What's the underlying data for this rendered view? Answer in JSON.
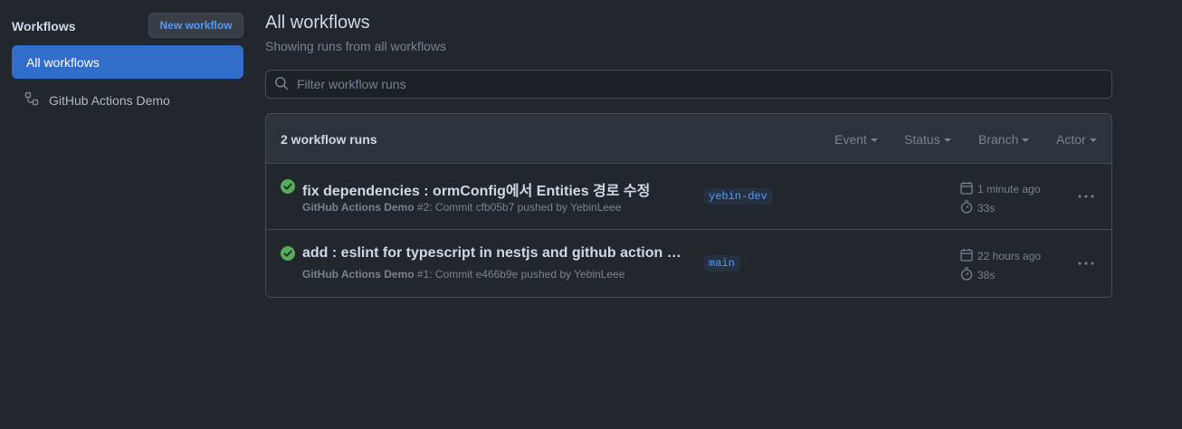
{
  "sidebar": {
    "title": "Workflows",
    "new_button": "New workflow",
    "items": [
      {
        "label": "All workflows",
        "active": true
      },
      {
        "label": "GitHub Actions Demo",
        "icon": "workflow-icon"
      }
    ]
  },
  "main": {
    "title": "All workflows",
    "subtitle": "Showing runs from all workflows",
    "filter_placeholder": "Filter workflow runs",
    "runs_count": "2 workflow runs",
    "filters": [
      "Event",
      "Status",
      "Branch",
      "Actor"
    ]
  },
  "runs": [
    {
      "status": "success",
      "title": "fix dependencies : ormConfig에서 Entities 경로 수정",
      "workflow": "GitHub Actions Demo",
      "meta": " #2: Commit cfb05b7 pushed by YebinLeee",
      "branch": "yebin-dev",
      "when": "1 minute ago",
      "duration": "33s"
    },
    {
      "status": "success",
      "title": "add : eslint for typescript in nestjs and github action workflow",
      "workflow": "GitHub Actions Demo",
      "meta": " #1: Commit e466b9e pushed by YebinLeee",
      "branch": "main",
      "when": "22 hours ago",
      "duration": "38s"
    }
  ],
  "colors": {
    "background": "#22272e",
    "accent": "#316dca",
    "link": "#539bf5",
    "success": "#57ab5a"
  }
}
